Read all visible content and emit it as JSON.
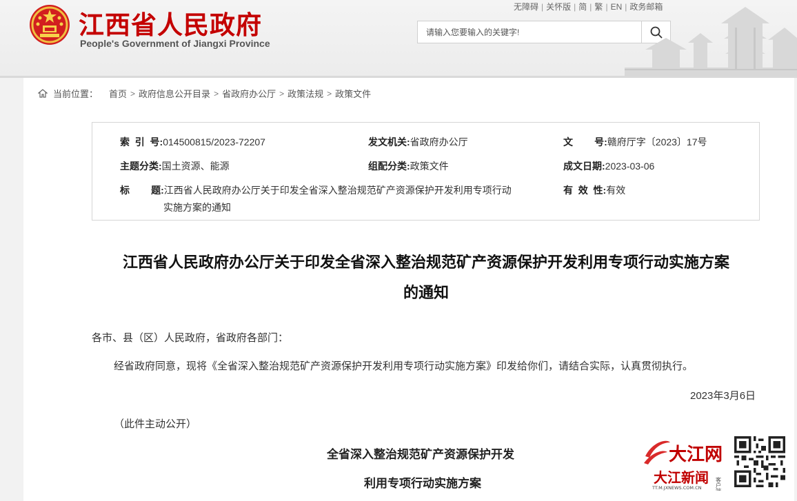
{
  "header": {
    "site_title": "江西省人民政府",
    "site_subtitle": "People's Government of Jiangxi Province",
    "toplinks": [
      "无障碍",
      "关怀版",
      "简",
      "繁",
      "EN",
      "政务邮箱"
    ],
    "search_placeholder": "请输入您要输入的关键字!"
  },
  "breadcrumb": {
    "label": "当前位置：",
    "items": [
      "首页",
      "政府信息公开目录",
      "省政府办公厅",
      "政策法规",
      "政策文件"
    ]
  },
  "meta": {
    "index_label": "索  引  号:",
    "index_value": "014500815/2023-72207",
    "issuer_label": "发文机关:",
    "issuer_value": "省政府办公厅",
    "docno_label": "文        号:",
    "docno_value": "赣府厅字〔2023〕17号",
    "topic_label": "主题分类:",
    "topic_value": "国土资源、能源",
    "group_label": "组配分类:",
    "group_value": "政策文件",
    "date_label": "成文日期:",
    "date_value": "2023-03-06",
    "title_label": "标        题:",
    "title_value_line1": "江西省人民政府办公厅关于印发全省深入整治规范矿产资源保护开发利用专项行动",
    "title_value_line2": "实施方案的通知",
    "valid_label": "有  效  性:",
    "valid_value": "有效"
  },
  "document": {
    "title_line1": "江西省人民政府办公厅关于印发全省深入整治规范矿产资源保护开发利用专项行动实施方案",
    "title_line2": "的通知",
    "salutation": "各市、县（区）人民政府，省政府各部门：",
    "body": "经省政府同意，现将《全省深入整治规范矿产资源保护开发利用专项行动实施方案》印发给你们，请结合实际，认真贯彻执行。",
    "date": "2023年3月6日",
    "disclosure": "（此件主动公开）",
    "plan_title_line1": "全省深入整治规范矿产资源保护开发",
    "plan_title_line2": "利用专项行动实施方案"
  },
  "watermark": {
    "brand": "大江网",
    "brand2": "大江新闻",
    "suffix": "客户端",
    "url": "TT.M.JXNEWS.COM.CN"
  },
  "colors": {
    "brand_red": "#c40000",
    "header_bg": "#efefef"
  }
}
